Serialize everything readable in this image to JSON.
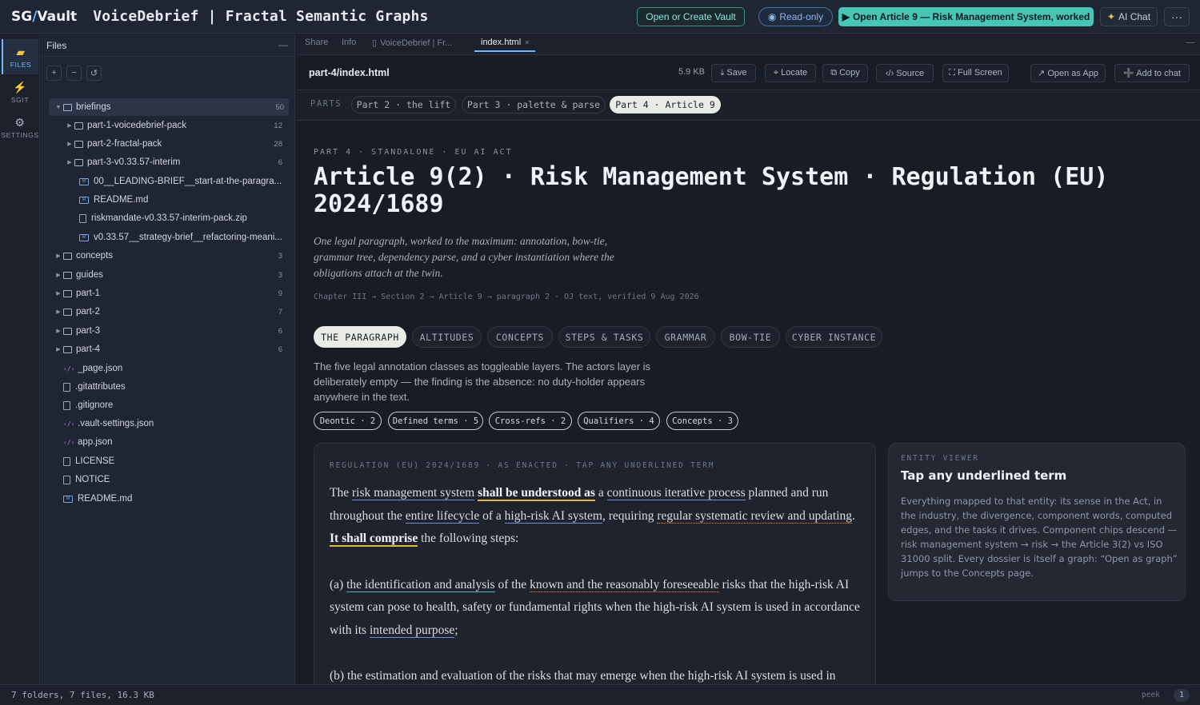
{
  "header": {
    "brand_a": "SG",
    "brand_slash": "/",
    "brand_b": "Vault",
    "title": "VoiceDebrief | Fractal Semantic Graphs",
    "open_vault": "Open or Create Vault",
    "read_only": "Read-only",
    "open_article": "Open Article 9 — Risk Management System, worked",
    "ai_chat": "AI Chat",
    "more": "···"
  },
  "rail": [
    {
      "label": "FILES",
      "icon": "folder-icon"
    },
    {
      "label": "SGIT",
      "icon": "plug-icon"
    },
    {
      "label": "SETTINGS",
      "icon": "gear-icon"
    }
  ],
  "files": {
    "title": "Files",
    "collapse": "—",
    "tools": [
      "+",
      "−",
      "↺"
    ],
    "tree": [
      {
        "name": "briefings",
        "type": "folder",
        "open": true,
        "count": "50"
      },
      {
        "name": "part-1-voicedebrief-pack",
        "type": "folder",
        "count": "12"
      },
      {
        "name": "part-2-fractal-pack",
        "type": "folder",
        "count": "28"
      },
      {
        "name": "part-3-v0.33.57-interim",
        "type": "folder",
        "count": "6"
      },
      {
        "name": "00__LEADING-BRIEF__start-at-the-paragra...",
        "type": "md"
      },
      {
        "name": "README.md",
        "type": "md"
      },
      {
        "name": "riskmandate-v0.33.57-interim-pack.zip",
        "type": "file"
      },
      {
        "name": "v0.33.57__strategy-brief__refactoring-meani...",
        "type": "md"
      },
      {
        "name": "concepts",
        "type": "folder",
        "count": "3"
      },
      {
        "name": "guides",
        "type": "folder",
        "count": "3"
      },
      {
        "name": "part-1",
        "type": "folder",
        "count": "9"
      },
      {
        "name": "part-2",
        "type": "folder",
        "count": "7"
      },
      {
        "name": "part-3",
        "type": "folder",
        "count": "6"
      },
      {
        "name": "part-4",
        "type": "folder",
        "count": "6"
      },
      {
        "name": "_page.json",
        "type": "code"
      },
      {
        "name": ".gitattributes",
        "type": "file"
      },
      {
        "name": ".gitignore",
        "type": "file"
      },
      {
        "name": ".vault-settings.json",
        "type": "code"
      },
      {
        "name": "app.json",
        "type": "code"
      },
      {
        "name": "LICENSE",
        "type": "file"
      },
      {
        "name": "NOTICE",
        "type": "file"
      },
      {
        "name": "README.md",
        "type": "md"
      }
    ]
  },
  "status": {
    "summary": "7 folders, 7 files, 16.3 KB",
    "peek": "peek",
    "count": "1"
  },
  "tabs": [
    {
      "label": "Share"
    },
    {
      "label": "Info"
    },
    {
      "label": "VoiceDebrief | Fr..."
    },
    {
      "label": "index.html",
      "close": "×"
    }
  ],
  "tabs_collapse": "—",
  "filebar": {
    "path": "part-4/index.html",
    "size": "5.9 KB",
    "buttons": [
      "⤓ Save",
      "⌖ Locate",
      "⧉ Copy",
      "‹/› Source",
      "⛶ Full Screen",
      "↗ Open as App",
      "➕ Add to chat"
    ]
  },
  "parts": {
    "label": "PARTS",
    "chips": [
      "Part 2 · the lift",
      "Part 3 · palette & parse",
      "Part 4 · Article 9"
    ]
  },
  "article": {
    "eyebrow": "PART 4 · STANDALONE · EU AI ACT",
    "headline": "Article 9(2) · Risk Management System · Regulation (EU) 2024/1689",
    "dek": "One legal paragraph, worked to the maximum: annotation, bow-tie, grammar tree, dependency parse, and a cyber instantiation where the obligations attach at the twin.",
    "trail": "Chapter III → Section 2 → Article 9 → paragraph 2 · OJ text, verified 9 Aug 2026",
    "view_tabs": [
      "THE PARAGRAPH",
      "ALTITUDES",
      "CONCEPTS",
      "STEPS & TASKS",
      "GRAMMAR",
      "BOW-TIE",
      "CYBER INSTANCE"
    ],
    "intro": "The five legal annotation classes as toggleable layers. The actors layer is deliberately empty — the finding is the absence: no duty-holder appears anywhere in the text.",
    "layers": [
      "Deontic · 2",
      "Defined terms · 5",
      "Cross-refs · 2",
      "Qualifiers · 4",
      "Concepts · 3"
    ]
  },
  "legal": {
    "eyebrow": "REGULATION (EU) 2024/1689 · AS ENACTED · TAP ANY UNDERLINED TERM",
    "p1": {
      "t1": "The ",
      "rms": "risk management system",
      "t2": " ",
      "shall": "shall be understood as",
      "t3": " a ",
      "cip": "continuous iterative process",
      "t4": " planned and run throughout the ",
      "lifecycle": "entire lifecycle",
      "t5": " of a ",
      "hrai": "high-risk AI system",
      "t6": ", requiring ",
      "review": "regular systematic review and updating",
      "t7": ". ",
      "comprise": "It shall comprise",
      "t8": " the following steps:"
    },
    "p2": {
      "t1": "(a) ",
      "ident": "the identification and analysis",
      "t2": " of the ",
      "known": "known and the reasonably foreseeable",
      "t3": " risks that the high-risk AI system can pose to health, safety or fundamental rights when the high-risk AI system is used in accordance with its ",
      "purpose": "intended purpose",
      "t4": ";"
    },
    "p3": "(b) the estimation and evaluation of the risks that may emerge when the high-risk AI system is used in"
  },
  "entity": {
    "eyebrow": "ENTITY VIEWER",
    "title": "Tap any underlined term",
    "body": "Everything mapped to that entity: its sense in the Act, in the industry, the divergence, component words, computed edges, and the tasks it drives. Component chips descend — risk management system → risk → the Article 3(2) vs ISO 31000 split. Every dossier is itself a graph: “Open as graph” jumps to the Concepts page."
  }
}
